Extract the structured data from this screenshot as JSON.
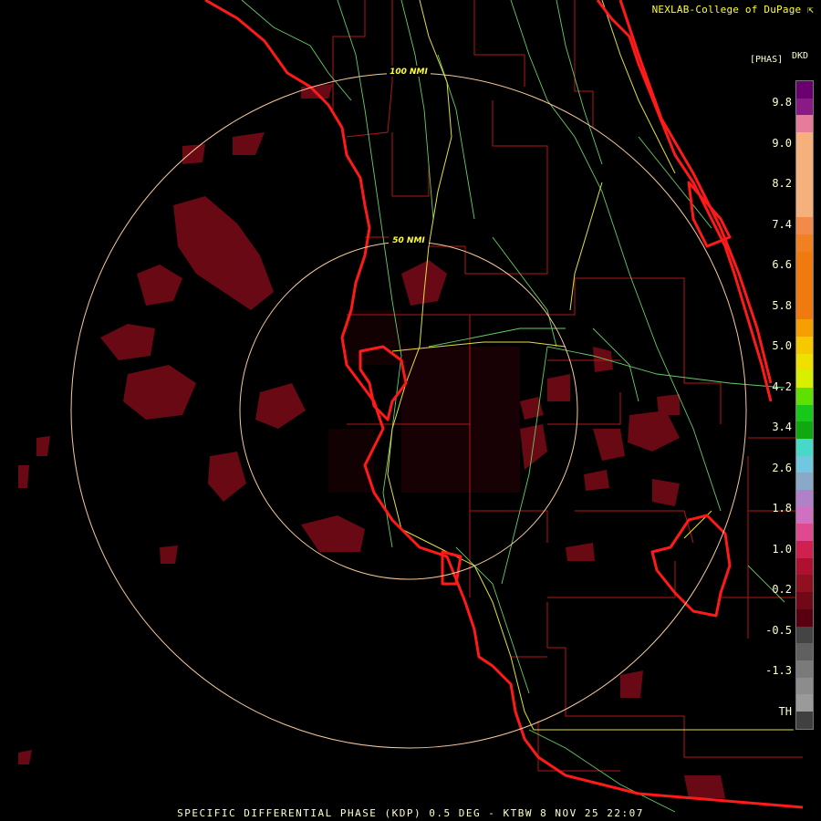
{
  "credit": "NEXLAB-College of DuPage",
  "credit_icon": "arrow-corner-icon",
  "legend": {
    "title": "[PHAS]",
    "code": "DKD",
    "ticks": [
      "9.8",
      "9.0",
      "8.2",
      "7.4",
      "6.6",
      "5.8",
      "5.0",
      "4.2",
      "3.4",
      "2.6",
      "1.8",
      "1.0",
      "0.2",
      "-0.5",
      "-1.3",
      "TH"
    ],
    "colors": [
      "#6a0070",
      "#8a1a86",
      "#e67b9c",
      "#f5b07c",
      "#f5b07c",
      "#f5b07c",
      "#f5b07c",
      "#f5b07c",
      "#f28a4a",
      "#f08020",
      "#f07a10",
      "#f07a10",
      "#f07a10",
      "#f07a10",
      "#f5a000",
      "#f5c800",
      "#f0e000",
      "#d8f000",
      "#5ee000",
      "#18c818",
      "#10a810",
      "#48d8c8",
      "#70c8e0",
      "#8aa8c8",
      "#b080c8",
      "#d070c0",
      "#e04890",
      "#d02050",
      "#b01030",
      "#901020",
      "#700818",
      "#580010",
      "#444444",
      "#606060",
      "#7a7a7a",
      "#8c8c8c",
      "#9a9a9a",
      "#404040"
    ],
    "edge_colors": {
      "outer_ring": "#ffcc99",
      "coast": "#ff1a1a",
      "county": "#c01818",
      "road_green": "#66cc66",
      "road_yellow": "#dddd44"
    }
  },
  "rings": [
    {
      "label": "100 NMI"
    },
    {
      "label": "50 NMI"
    }
  ],
  "footer": "SPECIFIC DIFFERENTIAL PHASE (KDP) 0.5 DEG - KTBW 8 NOV 25 22:07"
}
